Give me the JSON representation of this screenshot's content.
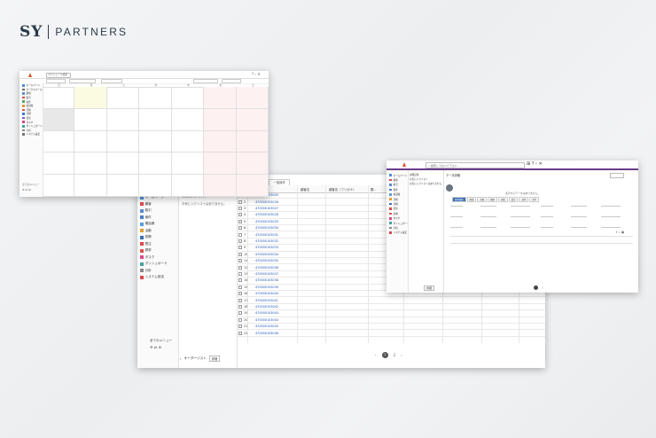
{
  "brand": {
    "sy": "SY",
    "partners": "PARTNERS"
  },
  "calendar_window": {
    "search_label": "スケジュール検索",
    "sidebar": [
      {
        "label": "ホームページ",
        "color": "#4a90d9"
      },
      {
        "label": "ワークスペース",
        "color": "#6a6a6a"
      },
      {
        "label": "顧客",
        "color": "#5b8bd0"
      },
      {
        "label": "取引",
        "color": "#d94a4a"
      },
      {
        "label": "案件",
        "color": "#5aa55a"
      },
      {
        "label": "電話帳",
        "color": "#e09a3a"
      },
      {
        "label": "活動",
        "color": "#d9534f"
      },
      {
        "label": "見積",
        "color": "#3a7bd5"
      },
      {
        "label": "受注",
        "color": "#7a5bc7"
      },
      {
        "label": "タスク",
        "color": "#d94a8c"
      },
      {
        "label": "ダッシュボード",
        "color": "#4aa0a0"
      },
      {
        "label": "分析",
        "color": "#888888"
      },
      {
        "label": "システム設定",
        "color": "#777777"
      }
    ],
    "sidebar_bottom": "全てのメニュー",
    "days": [
      "日",
      "月",
      "火",
      "水",
      "木",
      "金",
      "土"
    ]
  },
  "list_window": {
    "sidebar": [
      {
        "label": "ホームページ",
        "color": "#4a90d9"
      },
      {
        "label": "顧客",
        "color": "#d94a4a"
      },
      {
        "label": "取引",
        "color": "#5b8bd0"
      },
      {
        "label": "案件",
        "color": "#4a7fc7"
      },
      {
        "label": "電話帳",
        "color": "#5a9fd4"
      },
      {
        "label": "活動",
        "color": "#e0a030"
      },
      {
        "label": "見積",
        "color": "#3a6fb5"
      },
      {
        "label": "受注",
        "color": "#d94a4a"
      },
      {
        "label": "請求",
        "color": "#d9534f"
      },
      {
        "label": "タスク",
        "color": "#d94a8c"
      },
      {
        "label": "ダッシュボード",
        "color": "#4aa0a0"
      },
      {
        "label": "分析",
        "color": "#888888"
      },
      {
        "label": "システム設定",
        "color": "#d94a4a"
      }
    ],
    "panel_title": "お気に入りリスト",
    "panel_message": "お気に入りリストはありません。",
    "columns": [
      "顧客名",
      "顧客名（フリガナ）",
      "郵..."
    ],
    "toolbar_btn": "一括操作",
    "rows": [
      {
        "n": "1",
        "id": "470000103000"
      },
      {
        "n": "2",
        "id": "470000103026"
      },
      {
        "n": "3",
        "id": "470000103027"
      },
      {
        "n": "4",
        "id": "470000103028"
      },
      {
        "n": "5",
        "id": "470000103029"
      },
      {
        "n": "6",
        "id": "470000103030"
      },
      {
        "n": "7",
        "id": "470000103031"
      },
      {
        "n": "8",
        "id": "470000103032"
      },
      {
        "n": "9",
        "id": "470000103033"
      },
      {
        "n": "10",
        "id": "470000103034"
      },
      {
        "n": "11",
        "id": "470000103035"
      },
      {
        "n": "12",
        "id": "470000103036"
      },
      {
        "n": "13",
        "id": "470000103037"
      },
      {
        "n": "14",
        "id": "470000103038"
      },
      {
        "n": "15",
        "id": "470000103039"
      },
      {
        "n": "16",
        "id": "470000103040"
      },
      {
        "n": "17",
        "id": "470000103041"
      },
      {
        "n": "18",
        "id": "470000103042"
      },
      {
        "n": "19",
        "id": "470000103043"
      },
      {
        "n": "20",
        "id": "470000103044"
      },
      {
        "n": "21",
        "id": "470000103045"
      },
      {
        "n": "22",
        "id": "470000103046"
      }
    ],
    "sidebar_bottom": "全てのメニュー",
    "footer_label": "オーダーリスト",
    "footer_select": "詳細",
    "pager_current": "1",
    "pager_next": "2"
  },
  "detail_window": {
    "search_placeholder": "検索しておいて下さい",
    "title": "データ詳細",
    "left_items": [
      "詳細記録",
      "お気に入りリスト",
      "お気に入りリストはありません。"
    ],
    "tabs": [
      "基本情報",
      "関連",
      "活動",
      "履歴",
      "見積",
      "受注",
      "請求",
      "添付"
    ],
    "message": "表示するデータはありません。",
    "footer_btn": "詳細"
  }
}
